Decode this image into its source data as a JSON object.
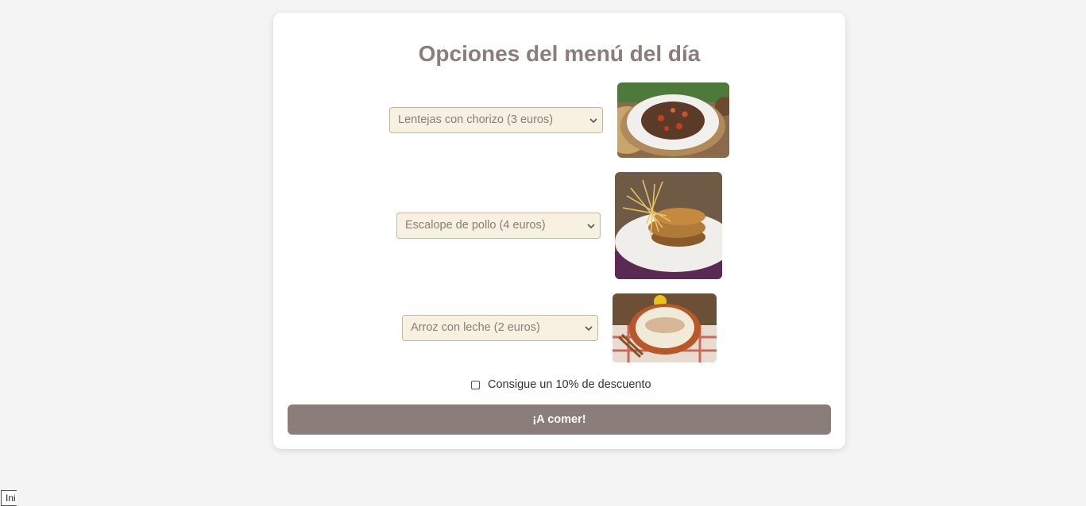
{
  "page": {
    "title": "Opciones del menú del día"
  },
  "dishes": [
    {
      "selected": "Lentejas con chorizo (3 euros)",
      "image_icon": "lentils-stew-photo"
    },
    {
      "selected": "Escalope de pollo (4 euros)",
      "image_icon": "chicken-escalope-photo"
    },
    {
      "selected": "Arroz con leche (2 euros)",
      "image_icon": "rice-pudding-photo"
    }
  ],
  "discount": {
    "label": "Consigue un 10% de descuento",
    "checked": false
  },
  "submit": {
    "label": "¡A comer!"
  },
  "corner": {
    "text": "Ini"
  },
  "colors": {
    "accent": "#8a7d7a",
    "select_bg": "#f8f0e0",
    "page_bg": "#f4f4f4"
  }
}
